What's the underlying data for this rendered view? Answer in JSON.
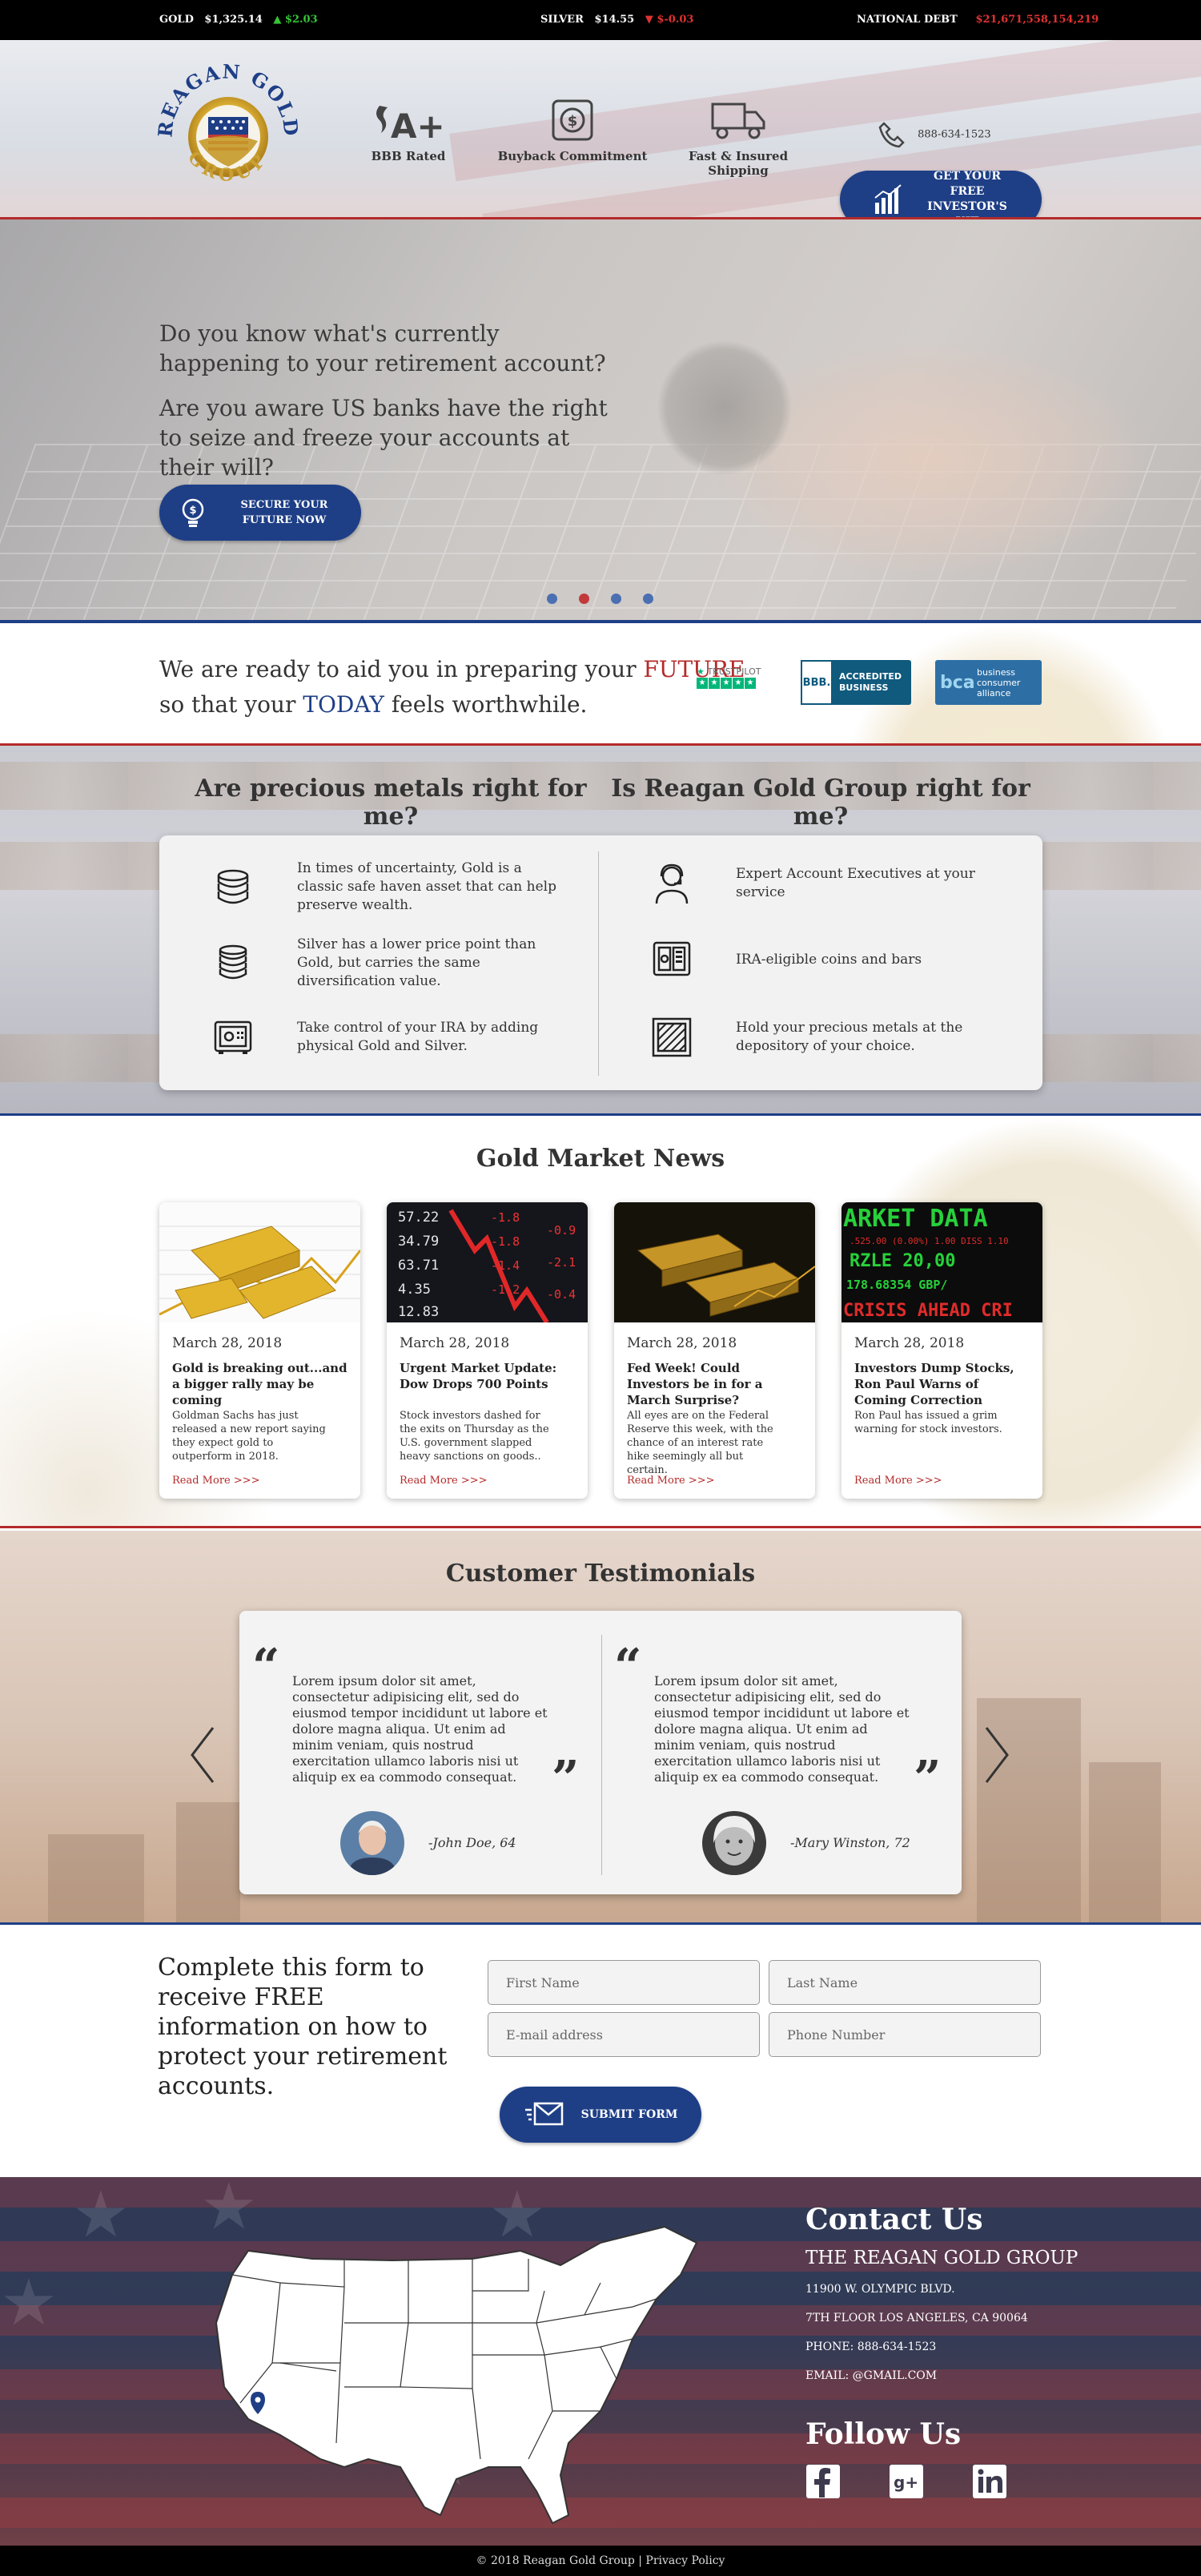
{
  "ticker": {
    "gold_label": "GOLD",
    "gold_price": "$1,325.14",
    "gold_change": "$2.03",
    "silver_label": "SILVER",
    "silver_price": "$14.55",
    "silver_change": "$-0.03",
    "debt_label": "NATIONAL DEBT",
    "debt_value": "$21,671,558,154,219"
  },
  "header": {
    "logo_top": "REAGAN GOLD",
    "logo_bottom": "GROUP",
    "features": [
      {
        "label": "BBB Rated",
        "icon": "a-plus-icon"
      },
      {
        "label": "Buyback Commitment",
        "icon": "dollar-cycle-icon"
      },
      {
        "label": "Fast & Insured Shipping",
        "icon": "truck-icon"
      }
    ],
    "phone": "888-634-1523",
    "kit_button": "GET YOUR FREE INVESTOR'S KIT"
  },
  "hero": {
    "question1": "Do you know what's currently happening to your retirement account?",
    "question2": "Are you aware US banks have the right to seize and freeze your accounts at their will?",
    "button": "SECURE YOUR FUTURE NOW",
    "active_slide": 2,
    "slide_count": 4
  },
  "ready": {
    "line1_pre": "We are ready to aid you in preparing your ",
    "line1_accent": "FUTURE",
    "line2_pre": "so that your ",
    "line2_accent": "TODAY",
    "line2_post": " feels worthwhile.",
    "trustpilot": "TRUSTPILOT",
    "bbb_label": "ACCREDITED BUSINESS",
    "bbb_mark": "BBB.",
    "bca_mark": "bca",
    "bca_label": "business consumer alliance"
  },
  "questions": {
    "left_heading": "Are precious metals right for me?",
    "right_heading": "Is Reagan Gold Group right for me?",
    "left_items": [
      "In times of uncertainty, Gold is a classic safe haven asset that can help preserve wealth.",
      "Silver has a lower price point than Gold, but carries the same diversification value.",
      "Take control of your IRA by adding physical Gold and Silver."
    ],
    "right_items": [
      "Expert Account Executives at your service",
      "IRA-eligible coins and bars",
      "Hold your precious metals at the depository of your choice."
    ]
  },
  "news": {
    "heading": "Gold Market News",
    "cards": [
      {
        "date": "March 28, 2018",
        "title": "Gold is breaking out...and a bigger rally may be coming",
        "excerpt": "Goldman Sachs has just released a new report saying they expect gold to outperform in 2018.",
        "more": "Read More >>>"
      },
      {
        "date": "March 28, 2018",
        "title": "Urgent Market Update: Dow Drops 700 Points",
        "excerpt": "Stock investors dashed for the exits on Thursday as the U.S. government slapped heavy sanctions on goods..",
        "more": "Read More >>>"
      },
      {
        "date": "March 28, 2018",
        "title": "Fed Week! Could Investors be in for a March Surprise?",
        "excerpt": "All eyes are on the Federal Reserve this week, with the chance of an interest rate hike seemingly all but certain.",
        "more": "Read More >>>"
      },
      {
        "date": "March 28, 2018",
        "title": "Investors Dump Stocks, Ron Paul Warns of Coming Correction",
        "excerpt": "Ron Paul has issued a grim warning for stock investors.",
        "more": "Read More >>>"
      }
    ],
    "ticker_words": [
      "57.22",
      "34.79",
      "63.71",
      "4.35",
      "12.83"
    ],
    "board_words": [
      "ARKET DATA",
      "RZLE 20,00",
      "178.68354 GBP/",
      "CRISIS AHEAD  CRI"
    ]
  },
  "testimonials": {
    "heading": "Customer Testimonials",
    "items": [
      {
        "quote": "Lorem ipsum dolor sit amet, consectetur adipisicing elit, sed do eiusmod tempor incididunt ut labore et dolore magna aliqua. Ut enim ad minim veniam, quis nostrud exercitation ullamco laboris nisi ut aliquip ex ea commodo consequat.",
        "name": "-John Doe, 64"
      },
      {
        "quote": "Lorem ipsum dolor sit amet, consectetur adipisicing elit, sed do eiusmod tempor incididunt ut labore et dolore magna aliqua. Ut enim ad minim veniam, quis nostrud exercitation ullamco laboris nisi ut aliquip ex ea commodo consequat.",
        "name": "-Mary Winston, 72"
      }
    ],
    "open_quote": "“",
    "close_quote": "”"
  },
  "form": {
    "intro": "Complete this form to receive FREE information on how to protect your retirement accounts.",
    "first_name": "First Name",
    "last_name": "Last Name",
    "email": "E-mail address",
    "phone": "Phone Number",
    "submit": "SUBMIT FORM"
  },
  "footer": {
    "contact_heading": "Contact Us",
    "company": "THE REAGAN GOLD GROUP",
    "address1": "11900 W. OLYMPIC BLVD.",
    "address2": "7TH FLOOR LOS ANGELES, CA 90064",
    "phone": "PHONE: 888-634-1523",
    "email": "EMAIL: @GMAIL.COM",
    "follow_heading": "Follow Us",
    "social": [
      "facebook-icon",
      "google-plus-icon",
      "linkedin-icon"
    ]
  },
  "bottom_bar": {
    "copyright": "© 2018 Reagan Gold Group",
    "separator": " | ",
    "privacy": "Privacy Policy"
  },
  "colors": {
    "brand_blue": "#1e3f86",
    "brand_red": "#b42a2a",
    "up_green": "#35c435",
    "down_red": "#e03232"
  }
}
